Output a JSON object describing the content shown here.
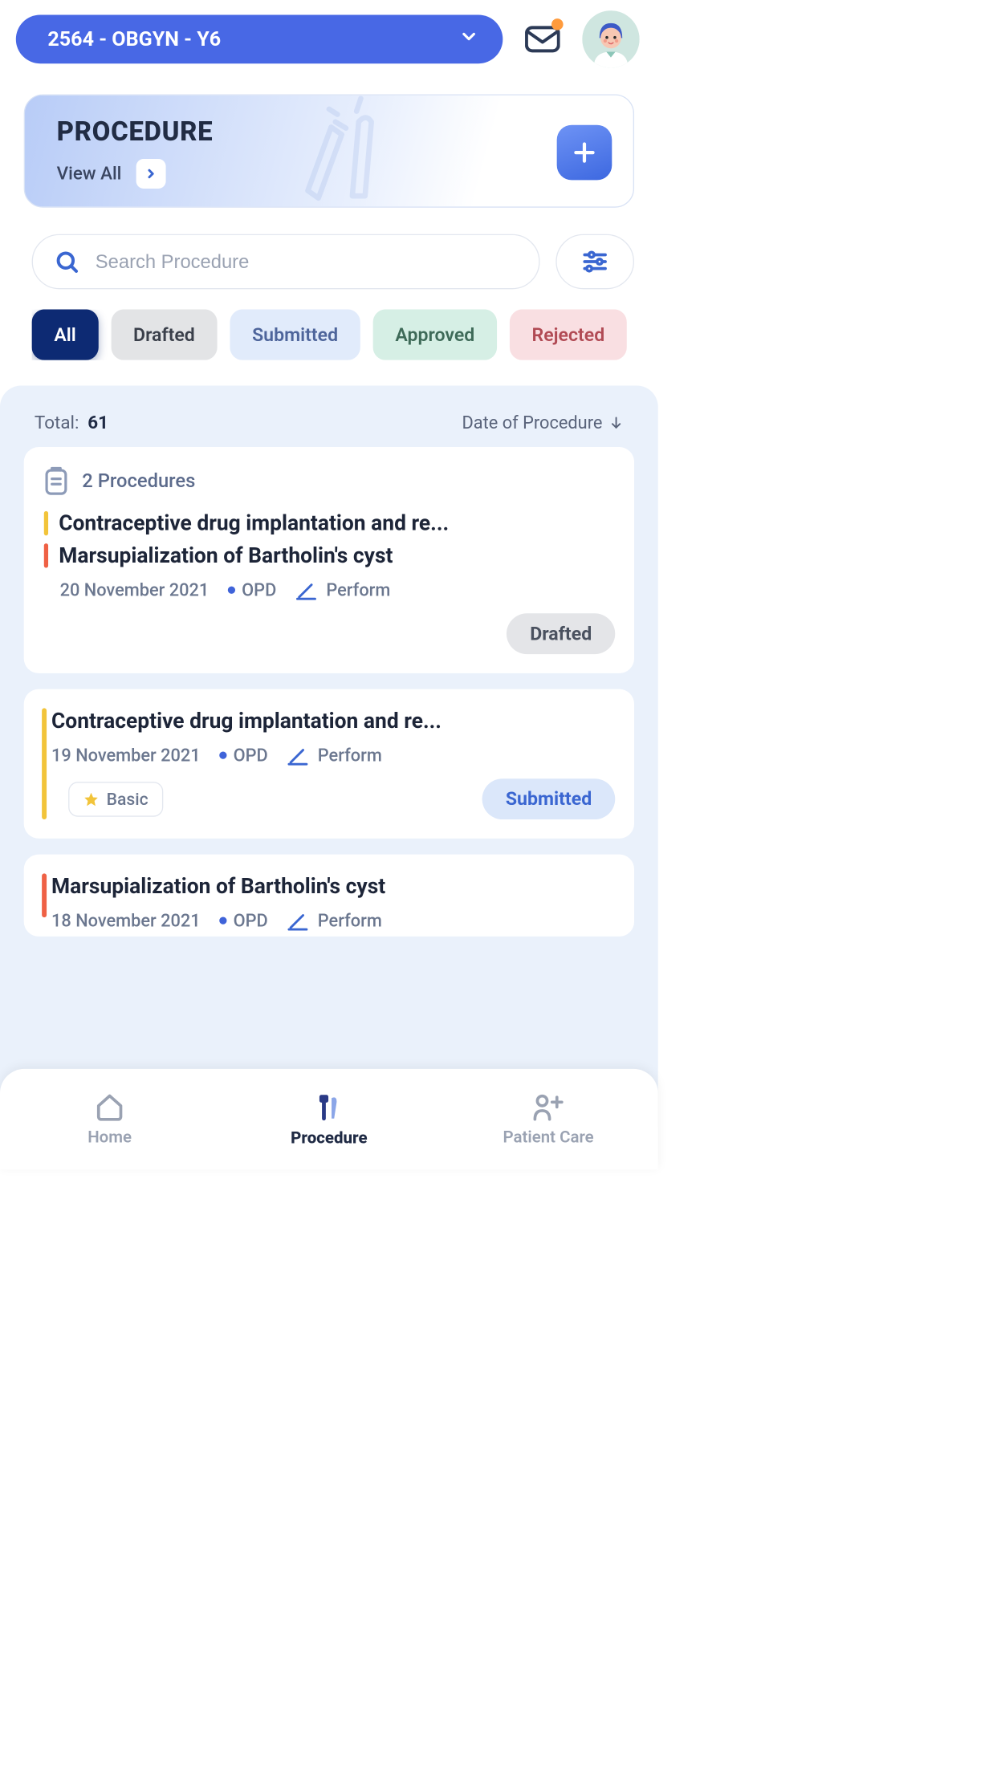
{
  "header": {
    "dropdown_label": "2564 - OBGYN - Y6"
  },
  "banner": {
    "title": "PROCEDURE",
    "view_all": "View All"
  },
  "search": {
    "placeholder": "Search Procedure"
  },
  "chips": {
    "all": "All",
    "drafted": "Drafted",
    "submitted": "Submitted",
    "approved": "Approved",
    "rejected": "Rejected"
  },
  "list": {
    "total_label": "Total:",
    "total_value": "61",
    "sort_label": "Date of Procedure"
  },
  "cards": [
    {
      "count_label": "2 Procedures",
      "procedures": [
        {
          "title": "Contraceptive drug implantation and re...",
          "bar": "yellow"
        },
        {
          "title": "Marsupialization of Bartholin's cyst",
          "bar": "red"
        }
      ],
      "date": "20 November 2021",
      "opd": "OPD",
      "action": "Perform",
      "status": "Drafted"
    },
    {
      "procedures": [
        {
          "title": "Contraceptive drug implantation and re..."
        }
      ],
      "date": "19 November 2021",
      "opd": "OPD",
      "action": "Perform",
      "badge": "Basic",
      "status": "Submitted"
    },
    {
      "procedures": [
        {
          "title": "Marsupialization of Bartholin's cyst"
        }
      ],
      "date": "18 November 2021",
      "opd": "OPD",
      "action": "Perform"
    }
  ],
  "nav": {
    "home": "Home",
    "procedure": "Procedure",
    "patient_care": "Patient Care"
  }
}
